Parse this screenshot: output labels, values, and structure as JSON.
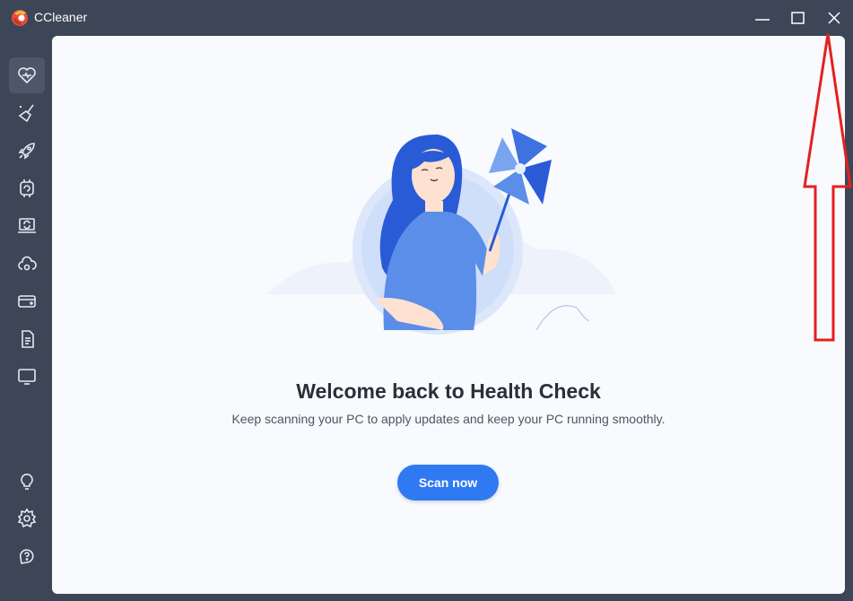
{
  "app": {
    "title": "CCleaner"
  },
  "window_controls": {
    "minimize": "minimize-icon",
    "maximize": "maximize-icon",
    "close": "close-icon"
  },
  "sidebar": {
    "items": [
      {
        "name": "health-check",
        "icon": "heart-icon",
        "active": true
      },
      {
        "name": "custom-clean",
        "icon": "broom-icon"
      },
      {
        "name": "performance-optimizer",
        "icon": "rocket-icon"
      },
      {
        "name": "driver-updater",
        "icon": "chip-icon"
      },
      {
        "name": "software-updater",
        "icon": "laptop-refresh-icon"
      },
      {
        "name": "cloud-settings",
        "icon": "cloud-gear-icon"
      },
      {
        "name": "registry",
        "icon": "drive-icon"
      },
      {
        "name": "tools",
        "icon": "document-icon"
      },
      {
        "name": "options",
        "icon": "monitor-icon"
      }
    ],
    "bottom": [
      {
        "name": "tips",
        "icon": "lightbulb-icon"
      },
      {
        "name": "settings",
        "icon": "gear-icon"
      },
      {
        "name": "help",
        "icon": "help-icon"
      }
    ]
  },
  "main": {
    "heading": "Welcome back to Health Check",
    "subtext": "Keep scanning your PC to apply updates and keep your PC running smoothly.",
    "scan_button": "Scan now"
  },
  "colors": {
    "titlebar": "#3d4656",
    "accent": "#2f7af2",
    "content_bg": "#f8fafd",
    "annotation": "#e52020"
  }
}
